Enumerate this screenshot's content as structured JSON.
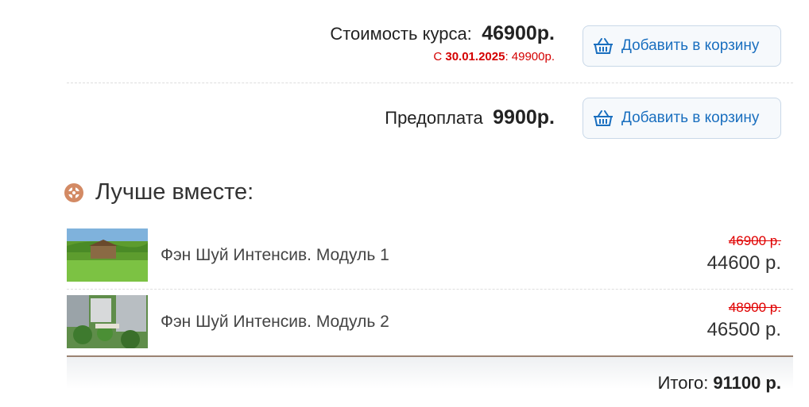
{
  "price_rows": [
    {
      "label": "Стоимость курса:",
      "value": "46900р.",
      "promo_prefix": "С ",
      "promo_date": "30.01.2025",
      "promo_suffix": ": 49900р.",
      "button": "Добавить в корзину"
    },
    {
      "label": "Предоплата",
      "value": "9900р.",
      "button": "Добавить в корзину"
    }
  ],
  "bundle": {
    "title": "Лучше вместе:",
    "items": [
      {
        "name": "Фэн Шуй Интенсив. Модуль 1",
        "old_price": "46900 р.",
        "new_price": "44600 р."
      },
      {
        "name": "Фэн Шуй Интенсив. Модуль 2",
        "old_price": "48900 р.",
        "new_price": "46500 р."
      }
    ],
    "total_label": "Итого:",
    "total_value": "91100 р."
  },
  "colors": {
    "accent": "#1a6fbf",
    "promo": "#d40000",
    "icon": "#d38a64"
  }
}
